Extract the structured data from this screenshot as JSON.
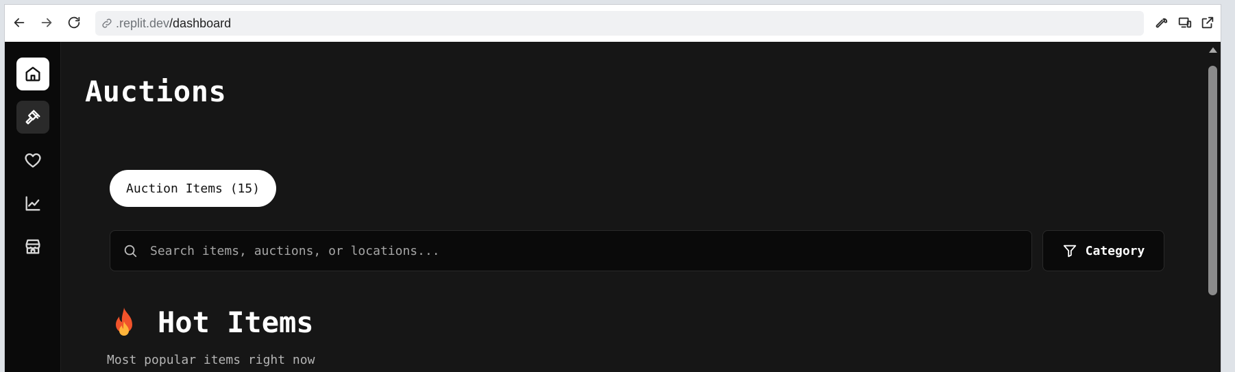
{
  "browser": {
    "url_host": ".replit.dev",
    "url_path": "/dashboard",
    "back_icon": "arrow-left-icon",
    "forward_icon": "arrow-right-icon",
    "reload_icon": "reload-icon",
    "tools": [
      "wrench-icon",
      "devices-icon",
      "open-external-icon"
    ]
  },
  "sidebar": {
    "items": [
      {
        "name": "home",
        "icon": "home-icon",
        "state": "active"
      },
      {
        "name": "auctions",
        "icon": "gavel-icon",
        "state": "hover"
      },
      {
        "name": "favorites",
        "icon": "heart-icon",
        "state": "normal"
      },
      {
        "name": "analytics",
        "icon": "chart-icon",
        "state": "normal"
      },
      {
        "name": "store",
        "icon": "store-icon",
        "state": "normal"
      }
    ]
  },
  "main": {
    "title": "Auctions",
    "tab_label": "Auction Items (15)",
    "search_placeholder": "Search items, auctions, or locations...",
    "category_button": "Category",
    "section_emoji_icon": "fire-icon",
    "section_title": "Hot Items",
    "section_subtitle": "Most popular items right now"
  },
  "colors": {
    "app_background": "#161616",
    "sidebar_background": "#0a0a0a",
    "active_nav": "#ffffff",
    "text_primary": "#ffffff",
    "text_muted": "#b5b5b5"
  }
}
